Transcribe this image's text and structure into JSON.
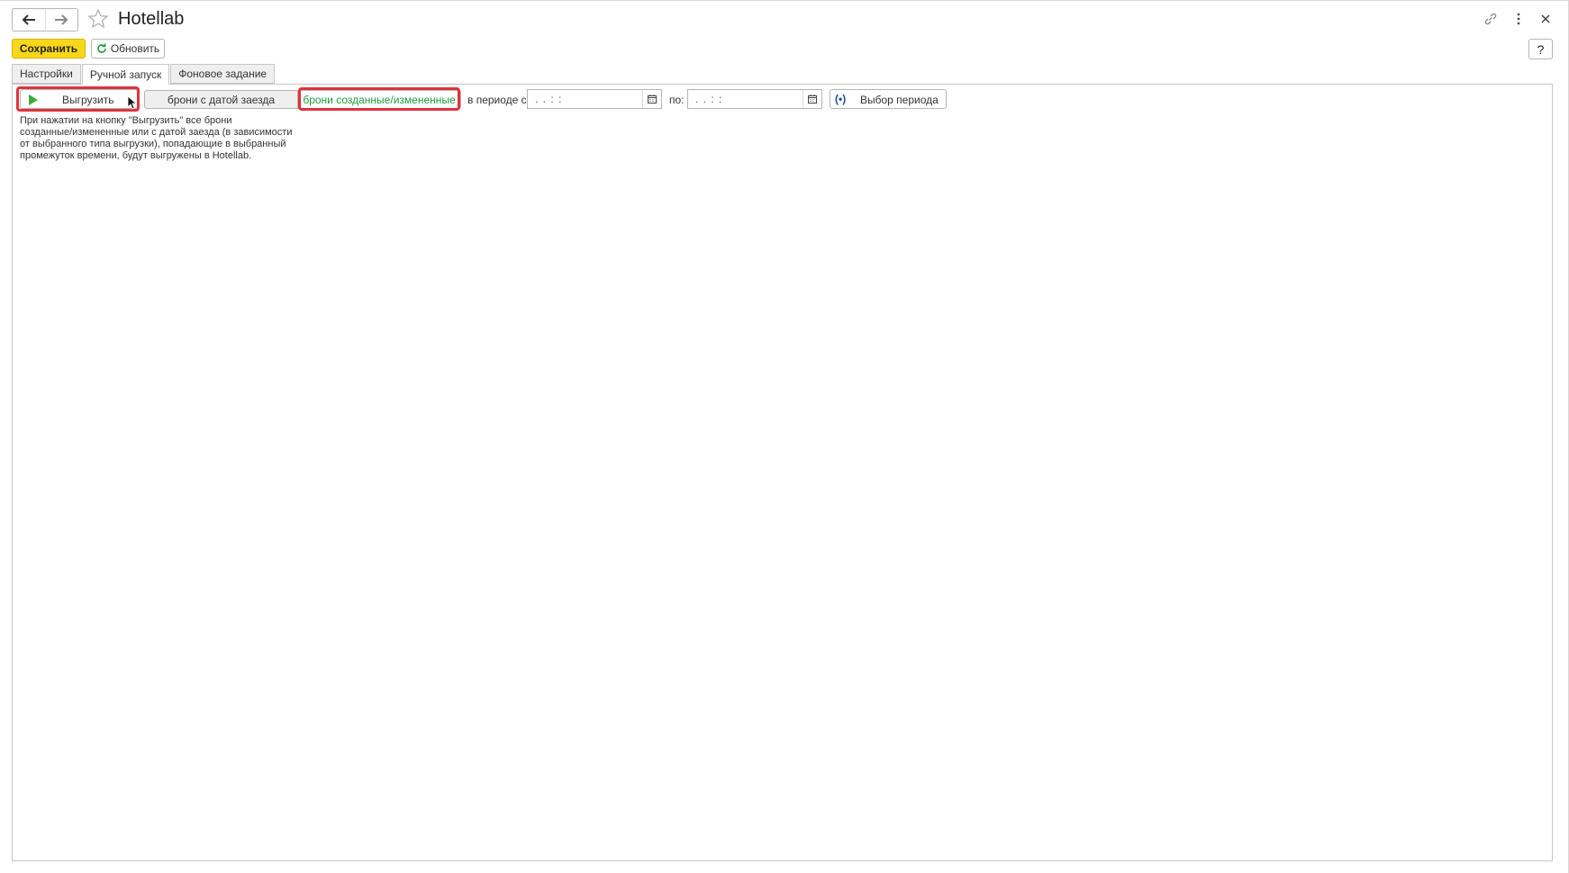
{
  "window": {
    "title": "Hotellab",
    "back_icon": "arrow-left-icon",
    "forward_icon": "arrow-right-icon",
    "favorite_icon": "star-icon",
    "link_icon": "link-icon",
    "more_icon": "more-vertical-icon",
    "close_icon": "close-icon"
  },
  "commandbar": {
    "save_label": "Сохранить",
    "refresh_label": "Обновить",
    "help_label": "?"
  },
  "tabs": [
    {
      "label": "Настройки",
      "active": false
    },
    {
      "label": "Ручной запуск",
      "active": true
    },
    {
      "label": "Фоновое задание",
      "active": false
    }
  ],
  "manual": {
    "run_label": "Выгрузить",
    "mode_options": [
      "брони с датой заезда",
      "брони созданные/измененные"
    ],
    "mode_selected": "брони созданные/измененные",
    "period_from_label": "в периоде с:",
    "period_from_value": ". .     : :",
    "period_to_label": "по:",
    "period_to_value": ". .     : :",
    "period_button_label": "Выбор периода",
    "description_lines": [
      "При нажатии на кнопку \"Выгрузить\" все брони",
      "созданные/измененные или с датой заезда (в зависимости",
      "от выбранного типа выгрузки), попадающие в выбранный",
      "промежуток времени, будут выгружены в Hotellab."
    ]
  },
  "colors": {
    "accent_yellow": "#f8d71a",
    "highlight_red": "#e0323c",
    "selected_green": "#1f9a3c",
    "play_green": "#3caa3c"
  }
}
